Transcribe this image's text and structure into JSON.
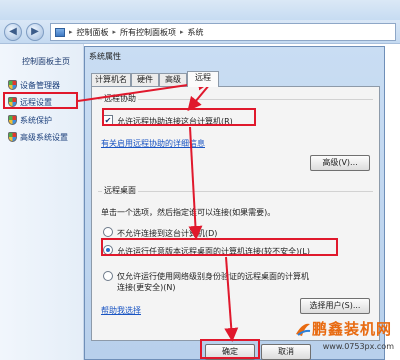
{
  "breadcrumb": {
    "parts": [
      "控制面板",
      "所有控制面板项",
      "系统"
    ]
  },
  "left_nav": {
    "home": "控制面板主页",
    "items": [
      {
        "label": "设备管理器"
      },
      {
        "label": "远程设置"
      },
      {
        "label": "系统保护"
      },
      {
        "label": "高级系统设置"
      }
    ]
  },
  "dialog": {
    "title": "系统属性",
    "tabs": [
      "计算机名",
      "硬件",
      "高级",
      "远程"
    ],
    "remote_assist": {
      "group_label": "远程协助",
      "allow_checkbox_label": "允许远程协助连接这台计算机(R)",
      "allow_checked": true,
      "help_link": "有关启用远程协助的详细信息",
      "advanced_button": "高级(V)..."
    },
    "remote_desktop": {
      "group_label": "远程桌面",
      "instruction": "单击一个选项，然后指定谁可以连接(如果需要)。",
      "option_deny": "不允许连接到这台计算机(D)",
      "option_any_line": "允许运行任意版本远程桌面的计算机连接(较不安全)(L)",
      "option_nla_line1": "仅允许运行使用网络级别身份验证的远程桌面的计算机",
      "option_nla_line2": "连接(更安全)(N)",
      "selected": "option_any",
      "help_link": "帮助我选择",
      "select_users_button": "选择用户(S)..."
    },
    "ok_button": "确定",
    "cancel_button": "取消"
  },
  "watermark": {
    "title": "鹏鑫装机网",
    "url": "www.0753px.com"
  },
  "colors": {
    "annotation_red": "#e0182c",
    "link_blue": "#1a55c3",
    "watermark_orange": "#e86a10"
  }
}
